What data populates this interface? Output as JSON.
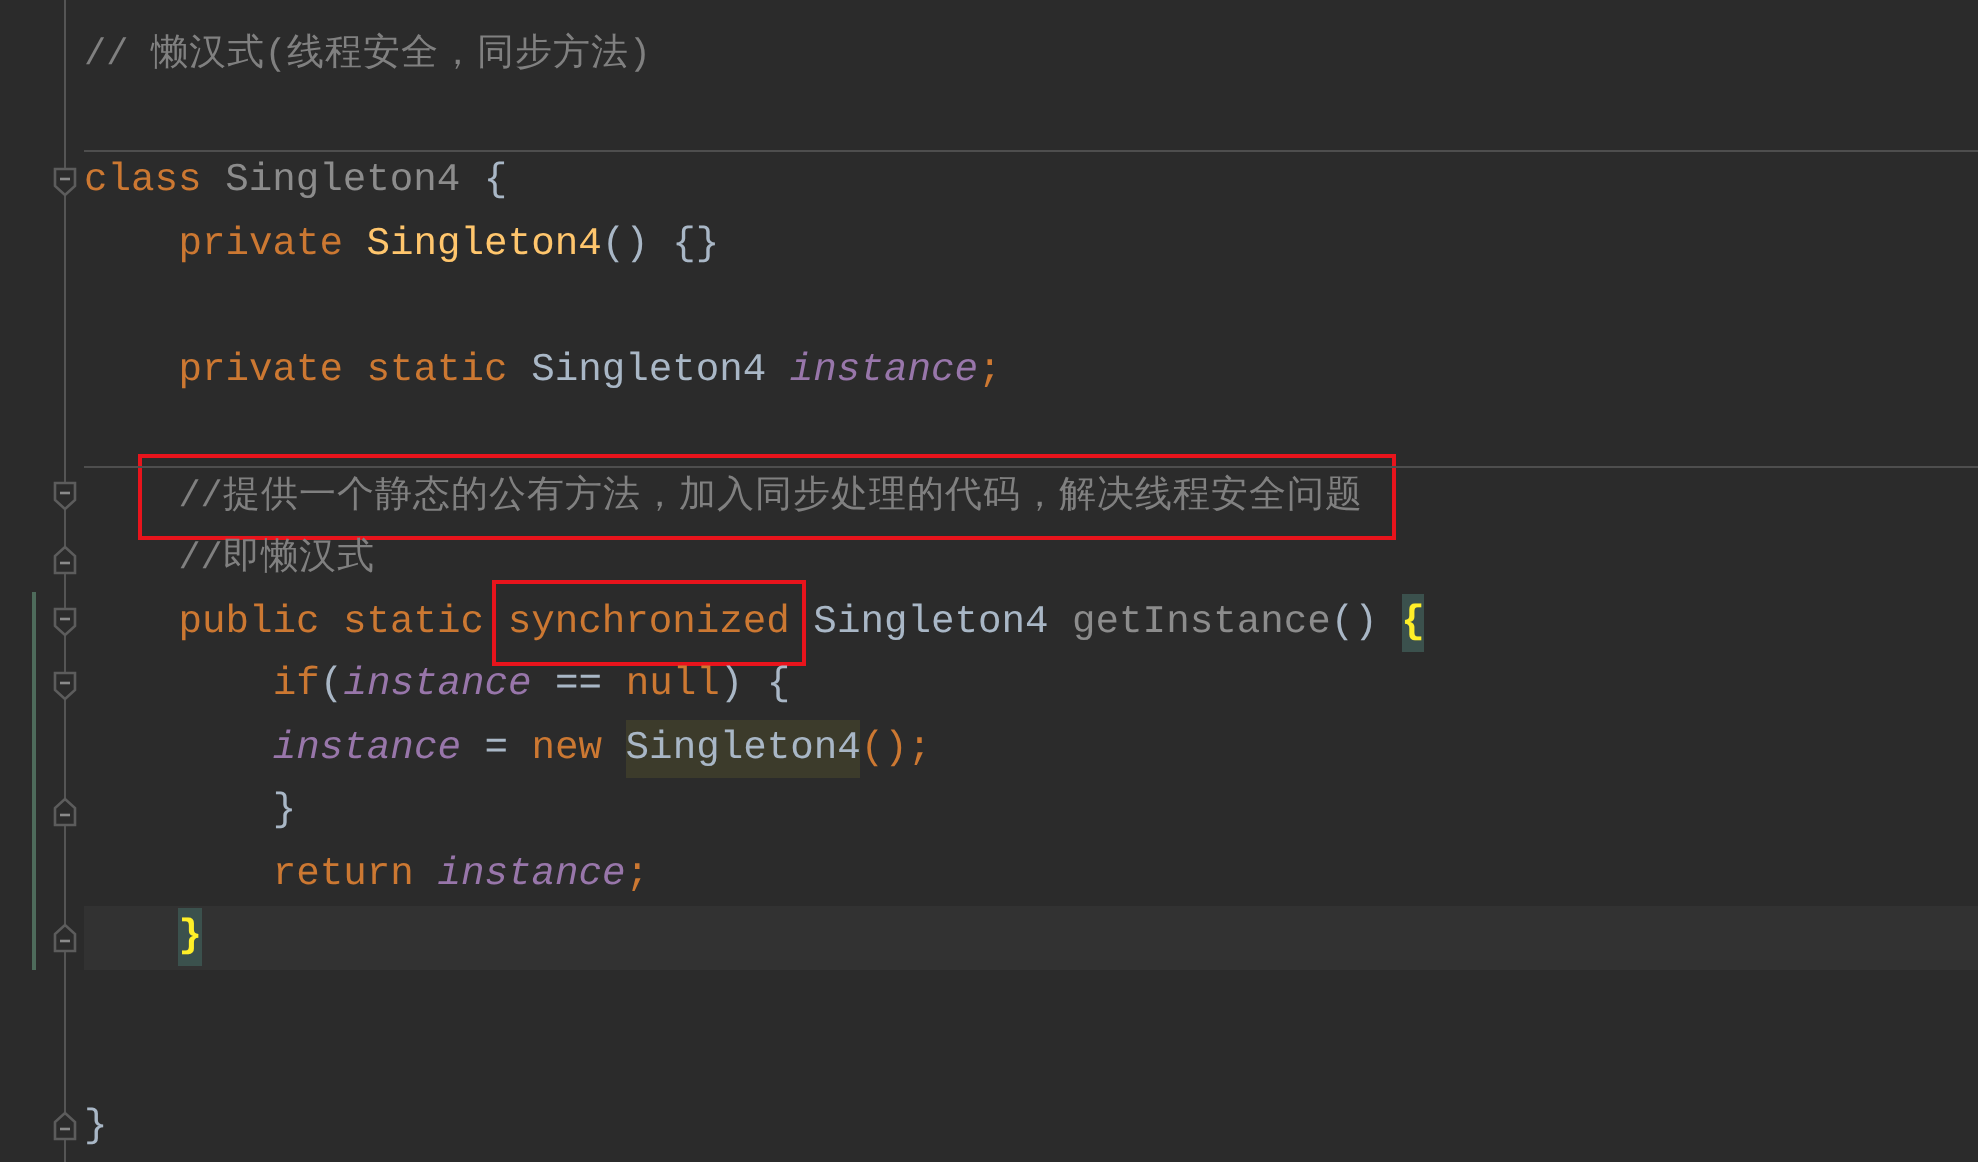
{
  "editor": {
    "lines": [
      {
        "tokens": [
          {
            "text": "// 懒汉式(线程安全，同步方法)",
            "kind": "comment",
            "boxed": false
          }
        ]
      },
      {
        "kind": "blank"
      },
      {
        "separator_above": true,
        "kind": "fold_start",
        "tokens": [
          {
            "text": "class ",
            "kind": "keyword",
            "boxed": false
          },
          {
            "text": "Singleton4 ",
            "kind": "unused",
            "boxed": false
          },
          {
            "text": "{",
            "kind": "plain",
            "boxed": false
          }
        ],
        "children": [
          {
            "tokens": [
              {
                "text": "private ",
                "kind": "keyword",
                "boxed": false
              },
              {
                "text": "Singleton4",
                "kind": "constructor",
                "boxed": false
              },
              {
                "text": "() {}",
                "kind": "plain",
                "boxed": false
              }
            ]
          },
          {
            "kind": "blank"
          },
          {
            "tokens": [
              {
                "text": "private static ",
                "kind": "keyword",
                "boxed": false
              },
              {
                "text": "Singleton4 ",
                "kind": "plain",
                "boxed": false
              },
              {
                "text": "instance",
                "kind": "field",
                "boxed": false
              },
              {
                "text": ";",
                "kind": "keyword",
                "boxed": false
              }
            ]
          },
          {
            "kind": "blank"
          },
          {
            "separator_above": true,
            "kind": "fold_start",
            "tokens": [
              {
                "text": "//提供一个静态的公有方法，加入同步处理的代码，解决线程安全问题",
                "kind": "comment",
                "boxed": true
              }
            ]
          },
          {
            "kind": "fold_end",
            "tokens": [
              {
                "text": "//即懒汉式",
                "kind": "comment",
                "boxed": false
              }
            ]
          },
          {
            "changed": true,
            "kind": "fold_start",
            "tokens": [
              {
                "text": "public static ",
                "kind": "keyword",
                "boxed": false
              },
              {
                "text": "synchronized",
                "kind": "keyword",
                "boxed": true
              },
              {
                "text": " Singleton4 ",
                "kind": "plain",
                "boxed": false
              },
              {
                "text": "getInstance",
                "kind": "unused",
                "boxed": false
              },
              {
                "text": "() ",
                "kind": "plain",
                "boxed": false
              },
              {
                "text": "{",
                "kind": "brace_match",
                "boxed": false
              }
            ],
            "children": [
              {
                "changed": true,
                "kind": "fold_start",
                "tokens": [
                  {
                    "text": "if",
                    "kind": "keyword",
                    "boxed": false
                  },
                  {
                    "text": "(",
                    "kind": "plain",
                    "boxed": false
                  },
                  {
                    "text": "instance",
                    "kind": "field",
                    "boxed": false
                  },
                  {
                    "text": " == ",
                    "kind": "plain",
                    "boxed": false
                  },
                  {
                    "text": "null",
                    "kind": "keyword",
                    "boxed": false
                  },
                  {
                    "text": ") {",
                    "kind": "plain",
                    "boxed": false
                  }
                ]
              },
              {
                "changed": true,
                "tokens": [
                  {
                    "text": "instance",
                    "kind": "field",
                    "boxed": false
                  },
                  {
                    "text": " = ",
                    "kind": "plain",
                    "boxed": false
                  },
                  {
                    "text": "new ",
                    "kind": "keyword",
                    "boxed": false
                  },
                  {
                    "text": "Singleton4",
                    "kind": "usage",
                    "boxed": false
                  },
                  {
                    "text": "();",
                    "kind": "keyword",
                    "boxed": false
                  }
                ]
              },
              {
                "changed": true,
                "kind": "fold_end",
                "tokens": [
                  {
                    "text": "}",
                    "kind": "plain",
                    "boxed": false
                  }
                ]
              },
              {
                "changed": true,
                "tokens": [
                  {
                    "text": "return ",
                    "kind": "keyword",
                    "boxed": false
                  },
                  {
                    "text": "instance",
                    "kind": "field",
                    "boxed": false
                  },
                  {
                    "text": ";",
                    "kind": "keyword",
                    "boxed": false
                  }
                ]
              }
            ]
          },
          {
            "changed": true,
            "current": true,
            "kind": "fold_end",
            "tokens": [
              {
                "text": "}",
                "kind": "brace_match",
                "boxed": false
              }
            ]
          },
          {
            "kind": "blank"
          },
          {
            "kind": "blank"
          }
        ]
      },
      {
        "kind": "fold_end",
        "tokens": [
          {
            "text": "}",
            "kind": "plain",
            "boxed": false
          }
        ]
      }
    ]
  }
}
